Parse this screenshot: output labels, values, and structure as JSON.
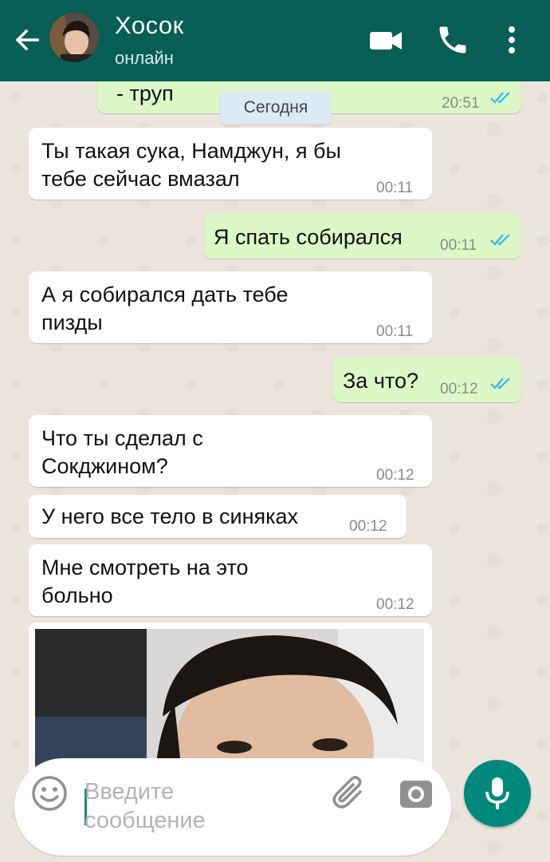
{
  "header": {
    "contact_name": "Хосок",
    "status": "онлайн"
  },
  "chat": {
    "date_label": "Сегодня",
    "messages": [
      {
        "direction": "out",
        "text": "- труп",
        "time": "20:51",
        "read": true
      },
      {
        "direction": "in",
        "text": "Ты такая сука, Намджун, я бы тебе сейчас вмазал",
        "time": "00:11"
      },
      {
        "direction": "out",
        "text": "Я спать собирался",
        "time": "00:11",
        "read": true
      },
      {
        "direction": "in",
        "text": "А я собирался дать тебе пизды",
        "time": "00:11"
      },
      {
        "direction": "out",
        "text": "За что?",
        "time": "00:12",
        "read": true
      },
      {
        "direction": "in",
        "text": "Что ты сделал с Сокджином?",
        "time": "00:12"
      },
      {
        "direction": "in",
        "text": "У него все тело в синяках",
        "time": "00:12"
      },
      {
        "direction": "in",
        "text": "Мне смотреть на это больно",
        "time": "00:12"
      },
      {
        "direction": "in",
        "type": "image"
      }
    ]
  },
  "input": {
    "placeholder": "Введите сообщение"
  },
  "colors": {
    "header_bg": "#075e54",
    "outgoing_bubble": "#dcf8c6",
    "incoming_bubble": "#ffffff",
    "read_ticks": "#34b7f1",
    "mic_button": "#00897b"
  },
  "icons": [
    "back-arrow-icon",
    "video-call-icon",
    "phone-icon",
    "more-vert-icon",
    "emoji-icon",
    "attach-icon",
    "camera-icon",
    "mic-icon"
  ]
}
